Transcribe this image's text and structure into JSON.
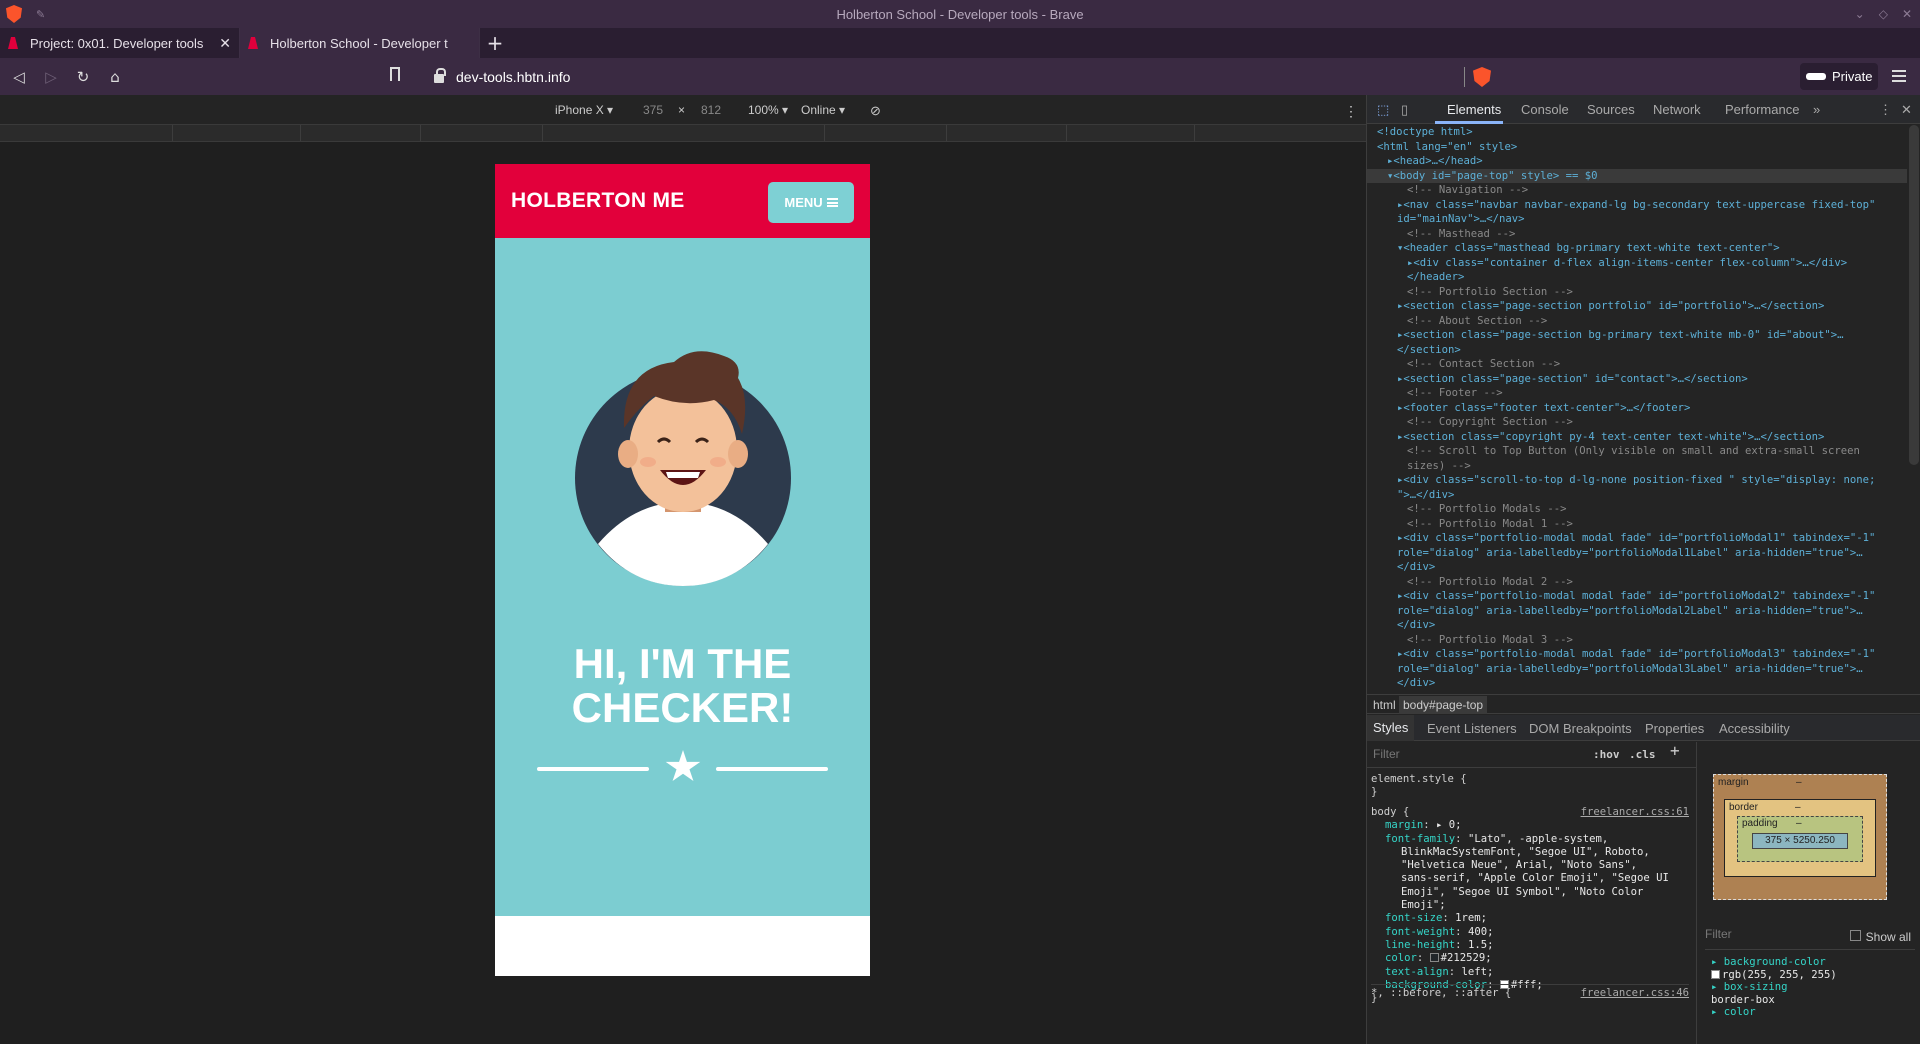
{
  "window": {
    "title": "Holberton School - Developer tools - Brave"
  },
  "tabs": [
    {
      "label": "Project: 0x01. Developer tools"
    },
    {
      "label": "Holberton School - Developer t"
    }
  ],
  "nav": {
    "url": "dev-tools.hbtn.info",
    "private_label": "Private"
  },
  "device_toolbar": {
    "device": "iPhone X",
    "width": "375",
    "times": "×",
    "height": "812",
    "zoom": "100%",
    "network": "Online"
  },
  "page": {
    "brand": "HOLBERTON ME",
    "menu_label": "MENU",
    "title_line1": "HI, I'M THE",
    "title_line2": "CHECKER!",
    "colors": {
      "nav": "#e2003b",
      "masthead": "#7ccdd1",
      "button": "#7ed0d4"
    }
  },
  "devtools": {
    "tabs": [
      "Elements",
      "Console",
      "Sources",
      "Network",
      "Performance",
      "»"
    ],
    "dom_lines": [
      {
        "indent": 0,
        "text": "<!doctype html>"
      },
      {
        "indent": 0,
        "text": "<html lang=\"en\" style>"
      },
      {
        "indent": 1,
        "text": "▸<head>…</head>"
      },
      {
        "indent": 1,
        "text": "▾<body id=\"page-top\" style> == $0",
        "selected": true
      },
      {
        "indent": 3,
        "text": "<!-- Navigation -->",
        "comment": true
      },
      {
        "indent": 2,
        "text": "▸<nav class=\"navbar navbar-expand-lg bg-secondary text-uppercase fixed-top\""
      },
      {
        "indent": 2,
        "text": "id=\"mainNav\">…</nav>"
      },
      {
        "indent": 3,
        "text": "<!-- Masthead -->",
        "comment": true
      },
      {
        "indent": 2,
        "text": "▾<header class=\"masthead bg-primary text-white text-center\">"
      },
      {
        "indent": 3,
        "text": "▸<div class=\"container d-flex align-items-center flex-column\">…</div>"
      },
      {
        "indent": 3,
        "text": "</header>"
      },
      {
        "indent": 3,
        "text": "<!-- Portfolio Section -->",
        "comment": true
      },
      {
        "indent": 2,
        "text": "▸<section class=\"page-section portfolio\" id=\"portfolio\">…</section>"
      },
      {
        "indent": 3,
        "text": "<!-- About Section -->",
        "comment": true
      },
      {
        "indent": 2,
        "text": "▸<section class=\"page-section bg-primary text-white mb-0\" id=\"about\">…"
      },
      {
        "indent": 2,
        "text": "</section>"
      },
      {
        "indent": 3,
        "text": "<!-- Contact Section -->",
        "comment": true
      },
      {
        "indent": 2,
        "text": "▸<section class=\"page-section\" id=\"contact\">…</section>"
      },
      {
        "indent": 3,
        "text": "<!-- Footer -->",
        "comment": true
      },
      {
        "indent": 2,
        "text": "▸<footer class=\"footer text-center\">…</footer>"
      },
      {
        "indent": 3,
        "text": "<!-- Copyright Section -->",
        "comment": true
      },
      {
        "indent": 2,
        "text": "▸<section class=\"copyright py-4 text-center text-white\">…</section>"
      },
      {
        "indent": 3,
        "text": "<!-- Scroll to Top Button (Only visible on small and extra-small screen",
        "comment": true
      },
      {
        "indent": 3,
        "text": "sizes) -->",
        "comment": true
      },
      {
        "indent": 2,
        "text": "▸<div class=\"scroll-to-top d-lg-none position-fixed \" style=\"display: none;"
      },
      {
        "indent": 2,
        "text": "\">…</div>"
      },
      {
        "indent": 3,
        "text": "<!-- Portfolio Modals -->",
        "comment": true
      },
      {
        "indent": 3,
        "text": "<!-- Portfolio Modal 1 -->",
        "comment": true
      },
      {
        "indent": 2,
        "text": "▸<div class=\"portfolio-modal modal fade\" id=\"portfolioModal1\" tabindex=\"-1\""
      },
      {
        "indent": 2,
        "text": "role=\"dialog\" aria-labelledby=\"portfolioModal1Label\" aria-hidden=\"true\">…"
      },
      {
        "indent": 2,
        "text": "</div>"
      },
      {
        "indent": 3,
        "text": "<!-- Portfolio Modal 2 -->",
        "comment": true
      },
      {
        "indent": 2,
        "text": "▸<div class=\"portfolio-modal modal fade\" id=\"portfolioModal2\" tabindex=\"-1\""
      },
      {
        "indent": 2,
        "text": "role=\"dialog\" aria-labelledby=\"portfolioModal2Label\" aria-hidden=\"true\">…"
      },
      {
        "indent": 2,
        "text": "</div>"
      },
      {
        "indent": 3,
        "text": "<!-- Portfolio Modal 3 -->",
        "comment": true
      },
      {
        "indent": 2,
        "text": "▸<div class=\"portfolio-modal modal fade\" id=\"portfolioModal3\" tabindex=\"-1\""
      },
      {
        "indent": 2,
        "text": "role=\"dialog\" aria-labelledby=\"portfolioModal3Label\" aria-hidden=\"true\">…"
      },
      {
        "indent": 2,
        "text": "</div>"
      }
    ],
    "breadcrumb": [
      "html",
      "body#page-top"
    ],
    "subtabs": [
      "Styles",
      "Event Listeners",
      "DOM Breakpoints",
      "Properties",
      "Accessibility"
    ],
    "styles_filter_placeholder": "Filter",
    "hov": ":hov",
    "cls": ".cls",
    "element_style": "element.style {",
    "close_brace": "}",
    "body_rule": {
      "selector": "body {",
      "source": "freelancer.css:61",
      "props": [
        {
          "name": "margin",
          "value": "▸ 0;"
        },
        {
          "name": "font-family",
          "value": "\"Lato\", -apple-system,"
        },
        {
          "name": "",
          "value": "BlinkMacSystemFont, \"Segoe UI\", Roboto,"
        },
        {
          "name": "",
          "value": "\"Helvetica Neue\", Arial, \"Noto Sans\","
        },
        {
          "name": "",
          "value": "sans-serif, \"Apple Color Emoji\", \"Segoe UI"
        },
        {
          "name": "",
          "value": "Emoji\", \"Segoe UI Symbol\", \"Noto Color"
        },
        {
          "name": "",
          "value": "Emoji\";"
        },
        {
          "name": "font-size",
          "value": "1rem;"
        },
        {
          "name": "font-weight",
          "value": "400;"
        },
        {
          "name": "line-height",
          "value": "1.5;"
        },
        {
          "name": "color",
          "value": "#212529;",
          "swatch": "#212529"
        },
        {
          "name": "text-align",
          "value": "left;"
        },
        {
          "name": "background-color",
          "value": "#fff;",
          "swatch": "#ffffff"
        }
      ]
    },
    "universal_rule": {
      "selector": "*, ::before, ::after {",
      "source": "freelancer.css:46"
    },
    "box_model": {
      "margin": "margin",
      "border": "border",
      "padding": "padding",
      "dash": "–",
      "content": "375 × 5250.250"
    },
    "computed": {
      "filter": "Filter",
      "show_all": "Show all",
      "items": [
        {
          "name": "background-color",
          "value": "rgb(255, 255, 255)"
        },
        {
          "name": "box-sizing",
          "value": "border-box"
        },
        {
          "name": "color",
          "value": ""
        }
      ]
    }
  }
}
